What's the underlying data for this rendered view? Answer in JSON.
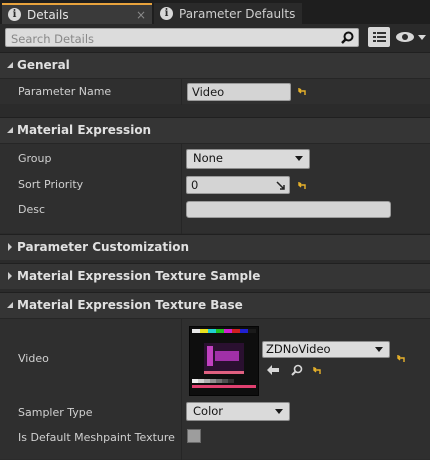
{
  "tabs": [
    {
      "label": "Details",
      "close": "×"
    },
    {
      "label": "Parameter Defaults"
    }
  ],
  "search": {
    "placeholder": "Search Details"
  },
  "sections": {
    "general": {
      "title": "General"
    },
    "material_expression": {
      "title": "Material Expression"
    },
    "parameter_customization": {
      "title": "Parameter Customization"
    },
    "texture_sample": {
      "title": "Material Expression Texture Sample"
    },
    "texture_base": {
      "title": "Material Expression Texture Base"
    }
  },
  "properties": {
    "parameter_name": {
      "label": "Parameter Name",
      "value": "Video"
    },
    "group": {
      "label": "Group",
      "value": "None"
    },
    "sort_priority": {
      "label": "Sort Priority",
      "value": "0"
    },
    "desc": {
      "label": "Desc",
      "value": ""
    },
    "video": {
      "label": "Video",
      "asset": "ZDNoVideo"
    },
    "sampler_type": {
      "label": "Sampler Type",
      "value": "Color"
    },
    "default_meshpaint": {
      "label": "Is Default Meshpaint Texture",
      "checked": false
    }
  },
  "colors": {
    "accent": "#e8a33d",
    "background": "#2b2b2b",
    "section_header": "#353535",
    "reset_arrow": "#e8b22a"
  }
}
